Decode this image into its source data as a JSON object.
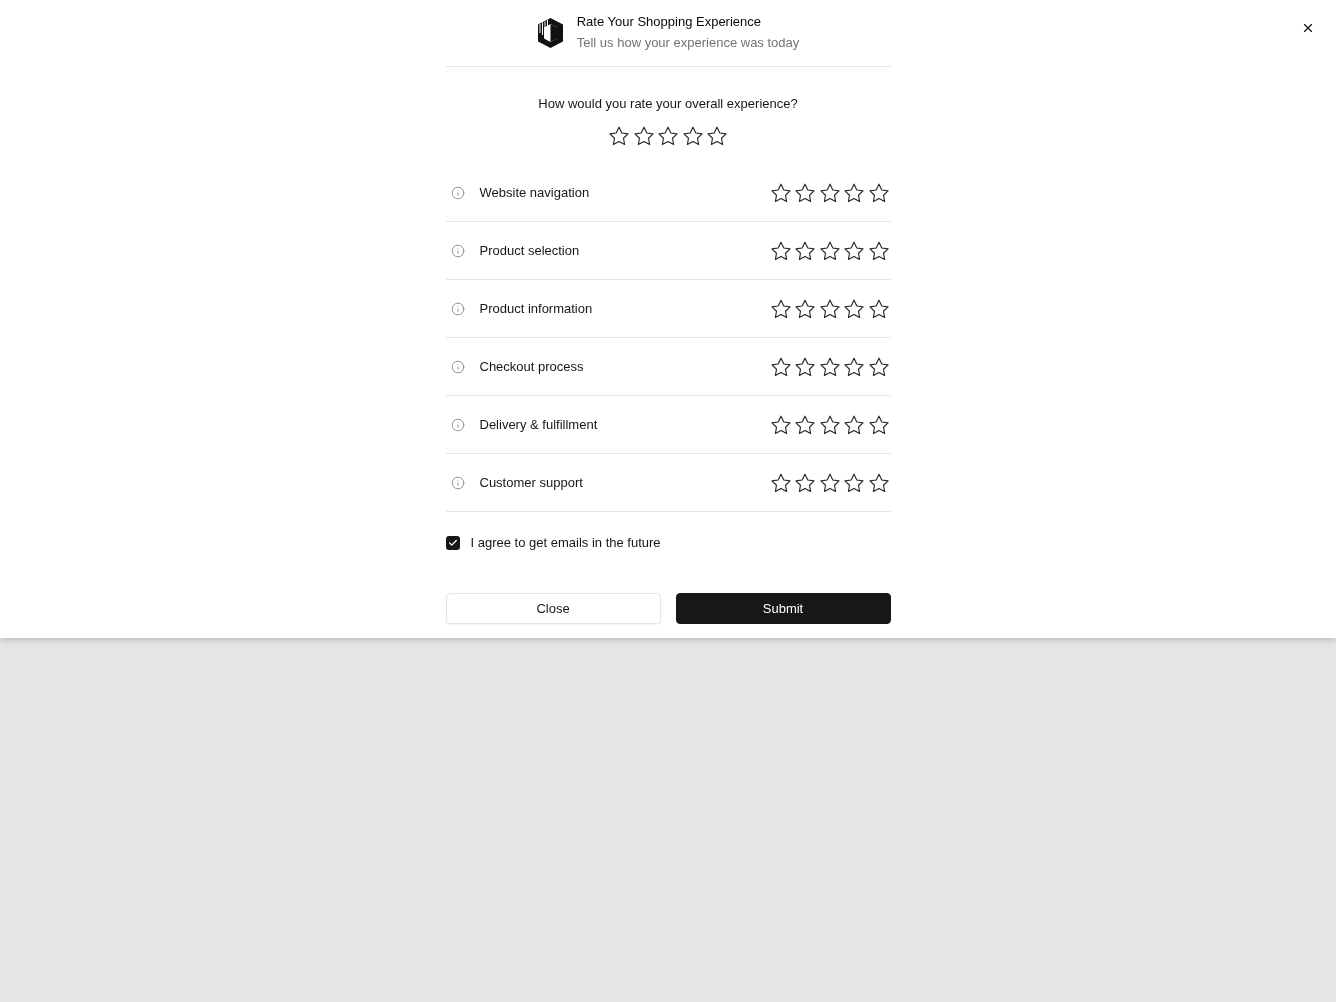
{
  "header": {
    "title": "Rate Your Shopping Experience",
    "subtitle": "Tell us how your experience was today"
  },
  "overall": {
    "question": "How would you rate your overall experience?",
    "stars": 0
  },
  "categories": [
    {
      "label": "Website navigation",
      "stars": 0
    },
    {
      "label": "Product selection",
      "stars": 0
    },
    {
      "label": "Product information",
      "stars": 0
    },
    {
      "label": "Checkout process",
      "stars": 0
    },
    {
      "label": "Delivery & fulfillment",
      "stars": 0
    },
    {
      "label": "Customer support",
      "stars": 0
    }
  ],
  "consent": {
    "label": "I agree to get emails in the future",
    "checked": true
  },
  "buttons": [
    {
      "label": "Close",
      "kind": "secondary"
    },
    {
      "label": "Submit",
      "kind": "primary"
    }
  ]
}
